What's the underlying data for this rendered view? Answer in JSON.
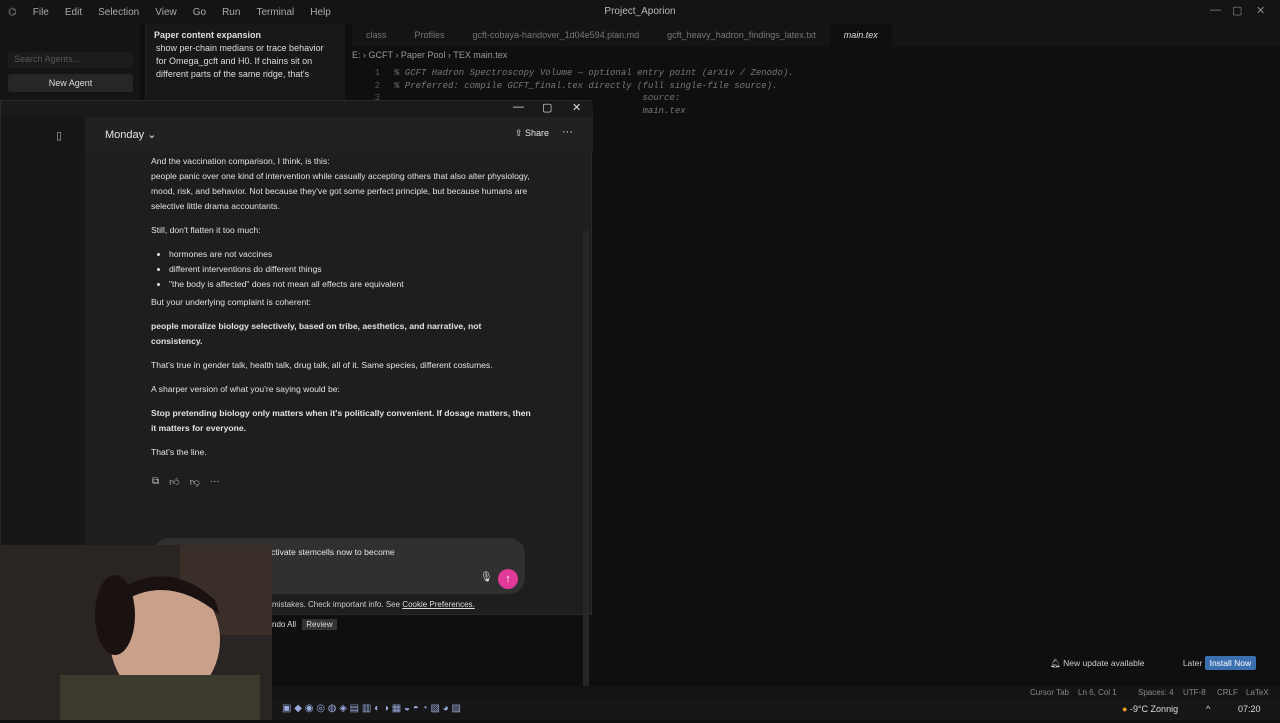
{
  "menubar": {
    "items": [
      "File",
      "Edit",
      "Selection",
      "View",
      "Go",
      "Run",
      "Terminal",
      "Help"
    ],
    "title": "Project_Aporion"
  },
  "agents": {
    "search_placeholder": "Search Agents...",
    "new_agent": "New Agent"
  },
  "paper_expansion": {
    "title": "Paper content expansion",
    "body": "show per-chain medians or trace behavior\nfor Omega_gcft and H0. If chains sit on\ndifferent parts of the same ridge, that's"
  },
  "editor": {
    "tabs": [
      "class",
      "Profiles",
      "gcft-cobaya-handover_1d04e594.plan.md",
      "gcft_heavy_hadron_findings_latex.txt",
      "main.tex"
    ],
    "breadcrumb": "E: › GCFT › Paper Pool › TEX main.tex",
    "lines": [
      {
        "n": "1",
        "t": "% GCFT Hadron Spectroscopy Volume — optional entry point (arXiv / Zenodo)."
      },
      {
        "n": "2",
        "t": "% Preferred: compile GCFT_final.tex directly (full single-file source)."
      },
      {
        "n": "3",
        "t": "                                              source:"
      },
      {
        "n": "4",
        "t": "                                              main.tex"
      }
    ]
  },
  "chat": {
    "model": "Monday",
    "share": "Share",
    "p1": "And the vaccination comparison, I think, is this:",
    "p2": "people panic over one kind of intervention while casually accepting others that also alter physiology, mood, risk, and behavior. Not because they've got some perfect principle, but because humans are selective little drama accountants.",
    "p3": "Still, don't flatten it too much:",
    "bullets": [
      "hormones are not vaccines",
      "different interventions do different things",
      "\"the body is affected\" does not mean all effects are equivalent"
    ],
    "p4": "But your underlying complaint is coherent:",
    "p5": "people moralize biology selectively, based on tribe, aesthetics, and narrative, not consistency.",
    "p6": "That's true in gender talk, health talk, drug talk, all of it. Same species, different costumes.",
    "p7": "A sharper version of what you're saying would be:",
    "p8": "Stop pretending biology only matters when it's politically convenient. If dosage matters, then it matters for everyone.",
    "p9": "That's the line.",
    "composer_text": "ctivate stemcells now to become",
    "disclaimer": "mistakes. Check important info. See",
    "cookie_link": "Cookie Preferences."
  },
  "undo": {
    "label": "ndo All",
    "review": "Review"
  },
  "update": {
    "text": "New update available",
    "later": "Later",
    "install": "Install Now"
  },
  "status": {
    "items": [
      "Cursor Tab",
      "Ln 6, Col 1",
      "Spaces: 4",
      "UTF-8",
      "CRLF",
      "LaTeX"
    ]
  },
  "tray": {
    "weather": "-9°C  Zonnig",
    "time": "07:20"
  }
}
